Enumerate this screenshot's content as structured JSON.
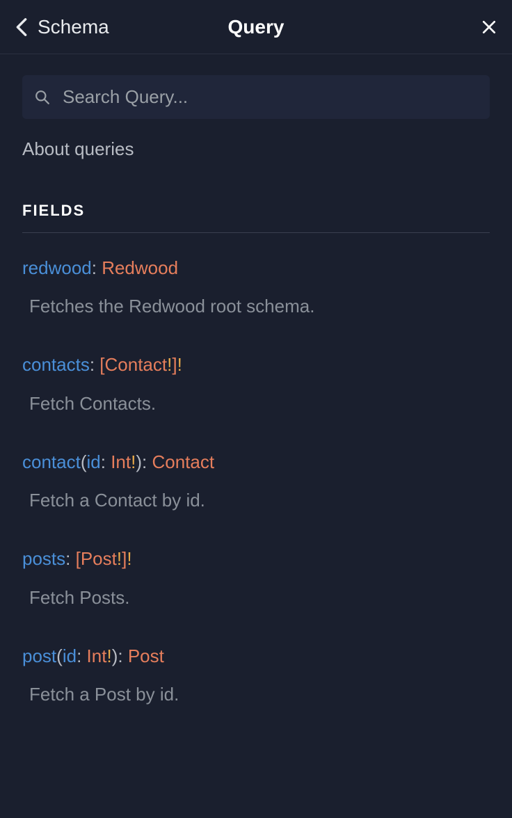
{
  "header": {
    "back_label": "Schema",
    "title": "Query"
  },
  "search": {
    "placeholder": "Search Query..."
  },
  "about_link": "About queries",
  "fields_heading": "FIELDS",
  "fields": [
    {
      "name": "redwood",
      "args": [],
      "return_bracket_open": "",
      "return_type": "Redwood",
      "return_bang": "",
      "return_bracket_close": "",
      "outer_bang": "",
      "description": "Fetches the Redwood root schema."
    },
    {
      "name": "contacts",
      "args": [],
      "return_bracket_open": "[",
      "return_type": "Contact",
      "return_bang": "!",
      "return_bracket_close": "]",
      "outer_bang": "!",
      "description": "Fetch Contacts."
    },
    {
      "name": "contact",
      "args": [
        {
          "name": "id",
          "type": "Int",
          "bang": "!"
        }
      ],
      "return_bracket_open": "",
      "return_type": "Contact",
      "return_bang": "",
      "return_bracket_close": "",
      "outer_bang": "",
      "description": "Fetch a Contact by id."
    },
    {
      "name": "posts",
      "args": [],
      "return_bracket_open": "[",
      "return_type": "Post",
      "return_bang": "!",
      "return_bracket_close": "]",
      "outer_bang": "!",
      "description": "Fetch Posts."
    },
    {
      "name": "post",
      "args": [
        {
          "name": "id",
          "type": "Int",
          "bang": "!"
        }
      ],
      "return_bracket_open": "",
      "return_type": "Post",
      "return_bang": "",
      "return_bracket_close": "",
      "outer_bang": "",
      "description": "Fetch a Post by id."
    }
  ]
}
